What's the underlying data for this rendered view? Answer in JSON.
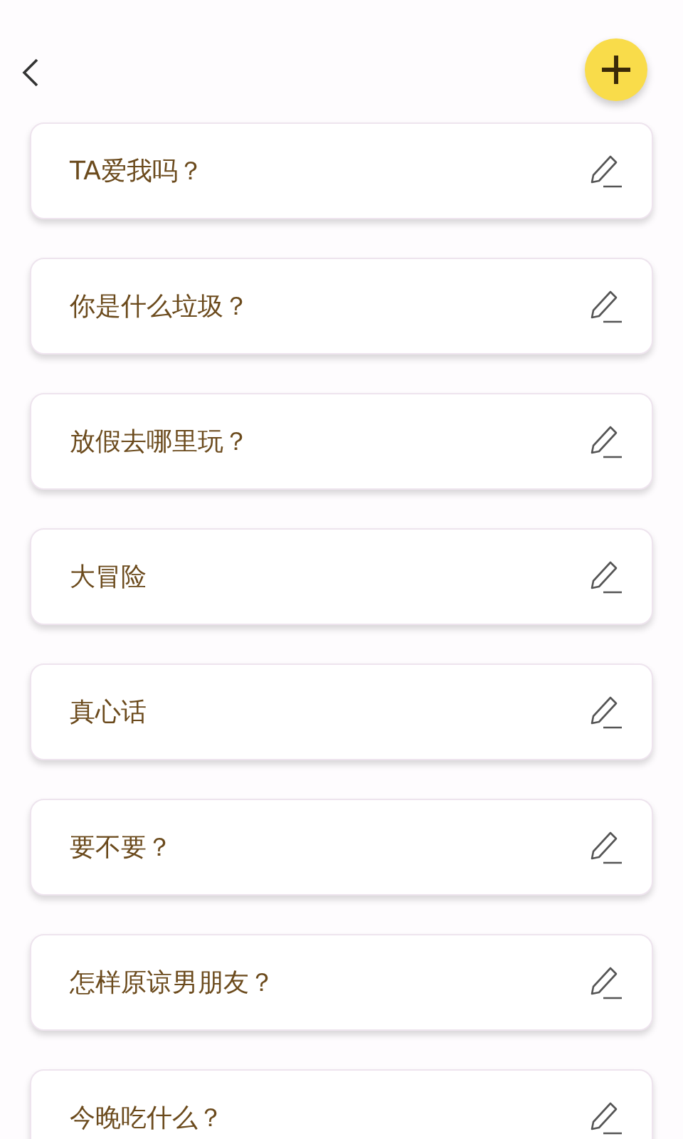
{
  "items": [
    {
      "title": "TA爱我吗？"
    },
    {
      "title": "你是什么垃圾？"
    },
    {
      "title": "放假去哪里玩？"
    },
    {
      "title": "大冒险"
    },
    {
      "title": "真心话"
    },
    {
      "title": "要不要？"
    },
    {
      "title": "怎样原谅男朋友？"
    },
    {
      "title": "今晚吃什么？"
    }
  ]
}
